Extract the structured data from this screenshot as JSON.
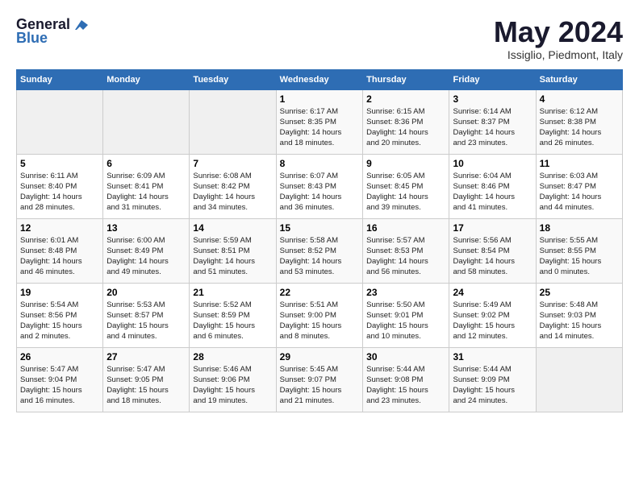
{
  "logo": {
    "line1": "General",
    "line2": "Blue"
  },
  "title": "May 2024",
  "location": "Issiglio, Piedmont, Italy",
  "days_of_week": [
    "Sunday",
    "Monday",
    "Tuesday",
    "Wednesday",
    "Thursday",
    "Friday",
    "Saturday"
  ],
  "weeks": [
    [
      {
        "day": "",
        "info": ""
      },
      {
        "day": "",
        "info": ""
      },
      {
        "day": "",
        "info": ""
      },
      {
        "day": "1",
        "info": "Sunrise: 6:17 AM\nSunset: 8:35 PM\nDaylight: 14 hours\nand 18 minutes."
      },
      {
        "day": "2",
        "info": "Sunrise: 6:15 AM\nSunset: 8:36 PM\nDaylight: 14 hours\nand 20 minutes."
      },
      {
        "day": "3",
        "info": "Sunrise: 6:14 AM\nSunset: 8:37 PM\nDaylight: 14 hours\nand 23 minutes."
      },
      {
        "day": "4",
        "info": "Sunrise: 6:12 AM\nSunset: 8:38 PM\nDaylight: 14 hours\nand 26 minutes."
      }
    ],
    [
      {
        "day": "5",
        "info": "Sunrise: 6:11 AM\nSunset: 8:40 PM\nDaylight: 14 hours\nand 28 minutes."
      },
      {
        "day": "6",
        "info": "Sunrise: 6:09 AM\nSunset: 8:41 PM\nDaylight: 14 hours\nand 31 minutes."
      },
      {
        "day": "7",
        "info": "Sunrise: 6:08 AM\nSunset: 8:42 PM\nDaylight: 14 hours\nand 34 minutes."
      },
      {
        "day": "8",
        "info": "Sunrise: 6:07 AM\nSunset: 8:43 PM\nDaylight: 14 hours\nand 36 minutes."
      },
      {
        "day": "9",
        "info": "Sunrise: 6:05 AM\nSunset: 8:45 PM\nDaylight: 14 hours\nand 39 minutes."
      },
      {
        "day": "10",
        "info": "Sunrise: 6:04 AM\nSunset: 8:46 PM\nDaylight: 14 hours\nand 41 minutes."
      },
      {
        "day": "11",
        "info": "Sunrise: 6:03 AM\nSunset: 8:47 PM\nDaylight: 14 hours\nand 44 minutes."
      }
    ],
    [
      {
        "day": "12",
        "info": "Sunrise: 6:01 AM\nSunset: 8:48 PM\nDaylight: 14 hours\nand 46 minutes."
      },
      {
        "day": "13",
        "info": "Sunrise: 6:00 AM\nSunset: 8:49 PM\nDaylight: 14 hours\nand 49 minutes."
      },
      {
        "day": "14",
        "info": "Sunrise: 5:59 AM\nSunset: 8:51 PM\nDaylight: 14 hours\nand 51 minutes."
      },
      {
        "day": "15",
        "info": "Sunrise: 5:58 AM\nSunset: 8:52 PM\nDaylight: 14 hours\nand 53 minutes."
      },
      {
        "day": "16",
        "info": "Sunrise: 5:57 AM\nSunset: 8:53 PM\nDaylight: 14 hours\nand 56 minutes."
      },
      {
        "day": "17",
        "info": "Sunrise: 5:56 AM\nSunset: 8:54 PM\nDaylight: 14 hours\nand 58 minutes."
      },
      {
        "day": "18",
        "info": "Sunrise: 5:55 AM\nSunset: 8:55 PM\nDaylight: 15 hours\nand 0 minutes."
      }
    ],
    [
      {
        "day": "19",
        "info": "Sunrise: 5:54 AM\nSunset: 8:56 PM\nDaylight: 15 hours\nand 2 minutes."
      },
      {
        "day": "20",
        "info": "Sunrise: 5:53 AM\nSunset: 8:57 PM\nDaylight: 15 hours\nand 4 minutes."
      },
      {
        "day": "21",
        "info": "Sunrise: 5:52 AM\nSunset: 8:59 PM\nDaylight: 15 hours\nand 6 minutes."
      },
      {
        "day": "22",
        "info": "Sunrise: 5:51 AM\nSunset: 9:00 PM\nDaylight: 15 hours\nand 8 minutes."
      },
      {
        "day": "23",
        "info": "Sunrise: 5:50 AM\nSunset: 9:01 PM\nDaylight: 15 hours\nand 10 minutes."
      },
      {
        "day": "24",
        "info": "Sunrise: 5:49 AM\nSunset: 9:02 PM\nDaylight: 15 hours\nand 12 minutes."
      },
      {
        "day": "25",
        "info": "Sunrise: 5:48 AM\nSunset: 9:03 PM\nDaylight: 15 hours\nand 14 minutes."
      }
    ],
    [
      {
        "day": "26",
        "info": "Sunrise: 5:47 AM\nSunset: 9:04 PM\nDaylight: 15 hours\nand 16 minutes."
      },
      {
        "day": "27",
        "info": "Sunrise: 5:47 AM\nSunset: 9:05 PM\nDaylight: 15 hours\nand 18 minutes."
      },
      {
        "day": "28",
        "info": "Sunrise: 5:46 AM\nSunset: 9:06 PM\nDaylight: 15 hours\nand 19 minutes."
      },
      {
        "day": "29",
        "info": "Sunrise: 5:45 AM\nSunset: 9:07 PM\nDaylight: 15 hours\nand 21 minutes."
      },
      {
        "day": "30",
        "info": "Sunrise: 5:44 AM\nSunset: 9:08 PM\nDaylight: 15 hours\nand 23 minutes."
      },
      {
        "day": "31",
        "info": "Sunrise: 5:44 AM\nSunset: 9:09 PM\nDaylight: 15 hours\nand 24 minutes."
      },
      {
        "day": "",
        "info": ""
      }
    ]
  ]
}
